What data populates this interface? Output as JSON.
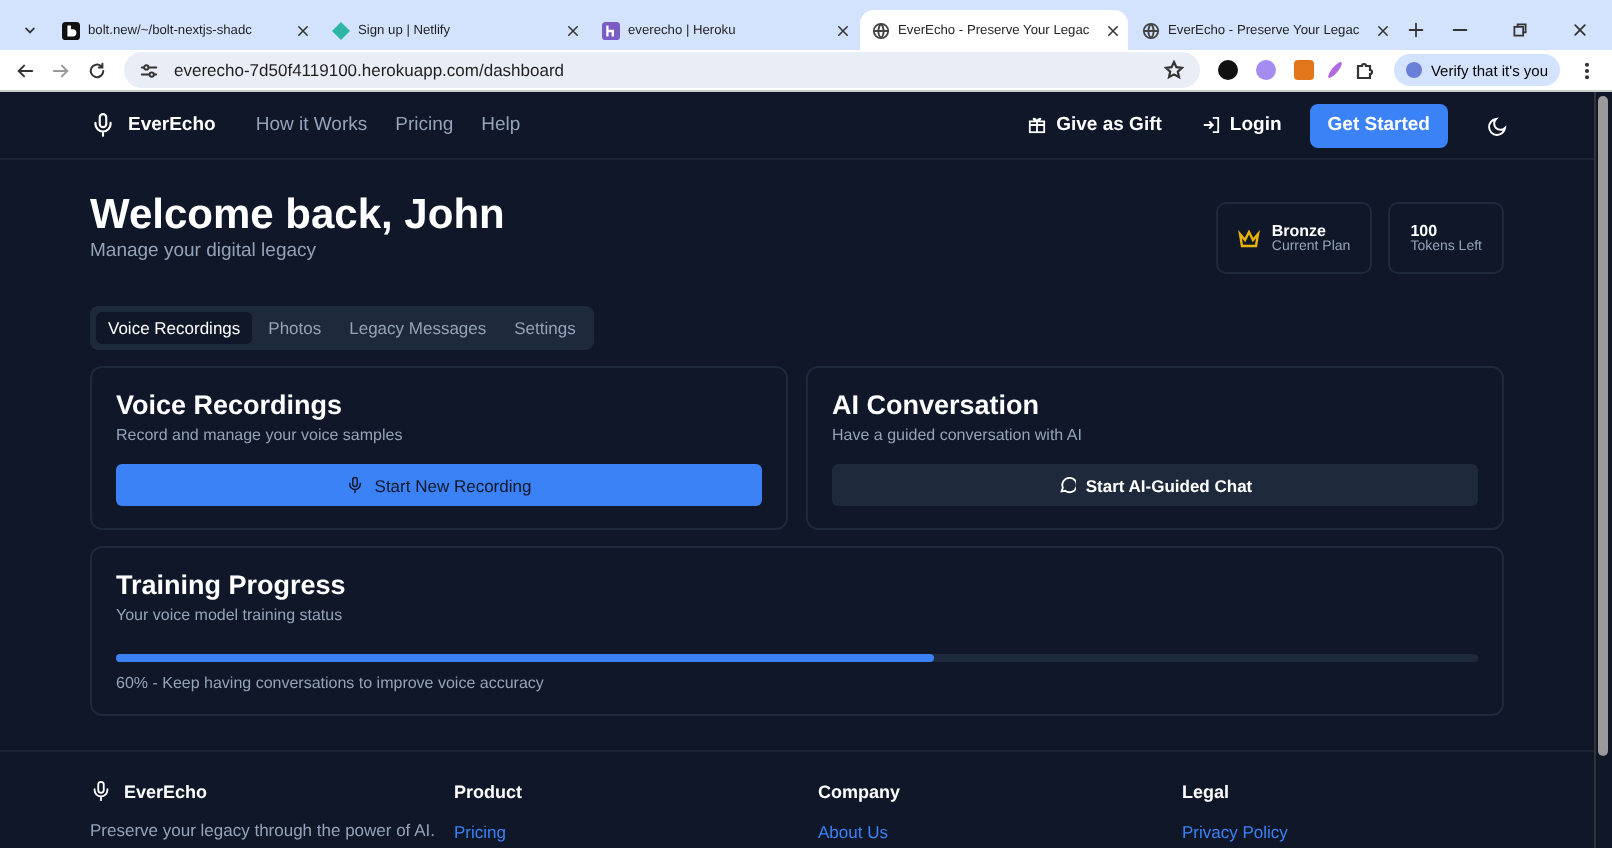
{
  "browser": {
    "tabs": [
      {
        "title": "bolt.new/~/bolt-nextjs-shadc",
        "kind": "bolt",
        "selected": false
      },
      {
        "title": "Sign up | Netlify",
        "kind": "netlify",
        "selected": false
      },
      {
        "title": "everecho | Heroku",
        "kind": "heroku",
        "selected": false
      },
      {
        "title": "EverEcho - Preserve Your Legac",
        "kind": "globe",
        "selected": true
      },
      {
        "title": "EverEcho - Preserve Your Legac",
        "kind": "globe",
        "selected": false
      }
    ],
    "address": "everecho-7d50f4119100.herokuapp.com/dashboard",
    "verify": "Verify that it's you"
  },
  "nav": {
    "brand": "EverEcho",
    "links": [
      "How it Works",
      "Pricing",
      "Help"
    ],
    "gift": "Give as Gift",
    "login": "Login",
    "cta": "Get Started"
  },
  "dashboard": {
    "title": "Welcome back, John",
    "subtitle": "Manage your digital legacy",
    "stats": [
      {
        "value": "Bronze",
        "label": "Current Plan",
        "kind": "plan"
      },
      {
        "value": "100",
        "label": "Tokens Left",
        "kind": "tokens"
      }
    ],
    "tabs": [
      {
        "label": "Voice Recordings",
        "selected": true
      },
      {
        "label": "Photos",
        "selected": false
      },
      {
        "label": "Legacy Messages",
        "selected": false
      },
      {
        "label": "Settings",
        "selected": false
      }
    ],
    "cards": [
      {
        "title": "Voice Recordings",
        "subtitle": "Record and manage your voice samples",
        "button": "Start New Recording",
        "kind": "record"
      },
      {
        "title": "AI Conversation",
        "subtitle": "Have a guided conversation with AI",
        "button": "Start AI-Guided Chat",
        "kind": "chat"
      }
    ],
    "training": {
      "title": "Training Progress",
      "subtitle": "Your voice model training status",
      "level": 0.6,
      "note": "60% - Keep having conversations to improve voice accuracy"
    }
  },
  "footer": {
    "brand": "EverEcho",
    "tagline": "Preserve your legacy through the power of AI.",
    "columns": [
      {
        "heading": "Product",
        "link": "Pricing"
      },
      {
        "heading": "Company",
        "link": "About Us"
      },
      {
        "heading": "Legal",
        "link": "Privacy Policy"
      }
    ]
  }
}
